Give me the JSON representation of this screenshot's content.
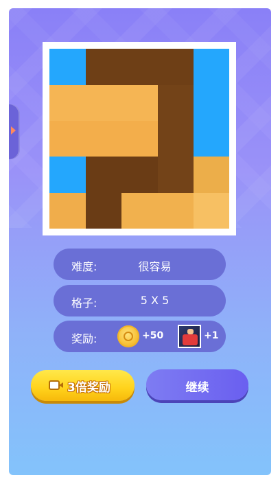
{
  "puzzle": {
    "grid_size": 5,
    "colors": {
      "blue": "#24a7fd",
      "brown_dark": "#6a3c15",
      "brown_mid": "#7a4a1c",
      "orange": "#f5b554",
      "orange_light": "#f7c063",
      "orange_dark": "#ecae4a"
    }
  },
  "info": {
    "difficulty_label": "难度:",
    "difficulty_value": "很容易",
    "grid_label": "格子:",
    "grid_value": "5 X 5",
    "reward_label": "奖励:",
    "coin_amount": "+50",
    "item_amount": "+1"
  },
  "buttons": {
    "triple_reward": "3倍奖励",
    "continue": "继续"
  },
  "icons": {
    "side_arrow": "chevron-right-icon",
    "coin": "coin-icon",
    "video": "video-camera-icon",
    "reward_item": "character-card-icon"
  }
}
